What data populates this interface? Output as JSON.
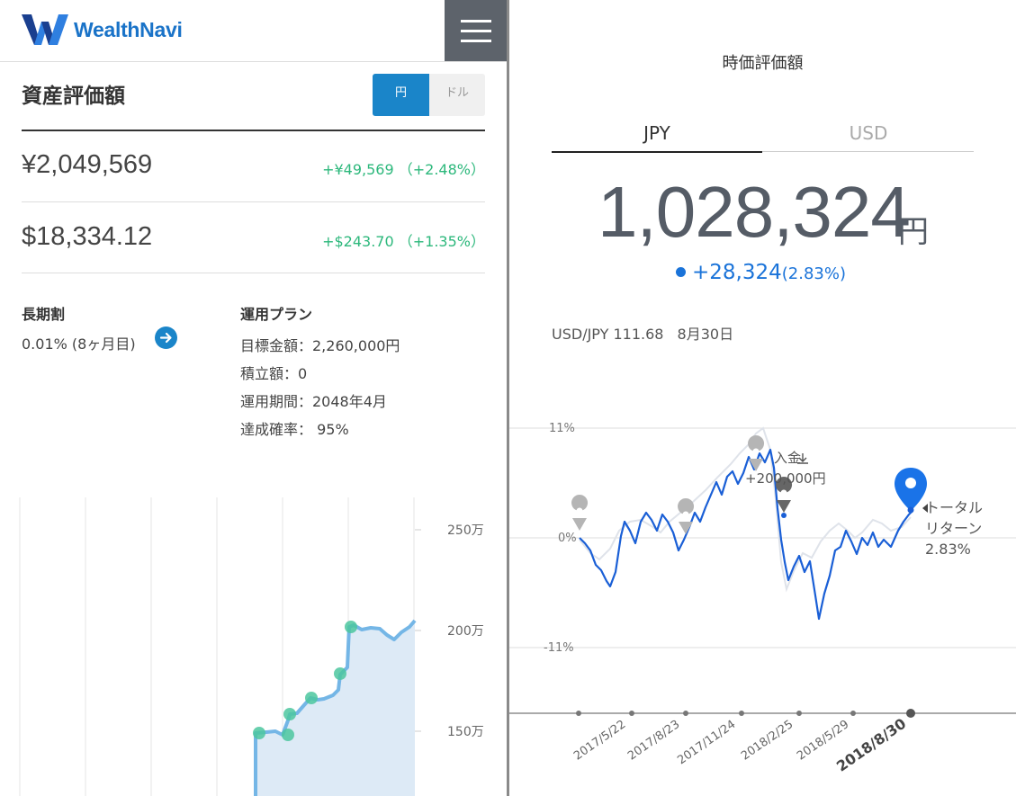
{
  "left": {
    "logo_text": "WealthNavi",
    "page_title": "資産評価額",
    "toggle": {
      "yen_label": "円",
      "dollar_label": "ドル"
    },
    "jpy": {
      "amount": "¥2,049,569",
      "change": "+¥49,569 （+2.48%）"
    },
    "usd": {
      "amount": "$18,334.12",
      "change": "+$243.70 （+1.35%）"
    },
    "long_term": {
      "heading": "長期割",
      "value": "0.01% (8ヶ月目)"
    },
    "plan": {
      "heading": "運用プラン",
      "target": "目標金額：2,260,000円",
      "accumulation": "積立額：0",
      "period": "運用期間：2048年4月",
      "probability": "達成確率： 95%"
    },
    "chart": {
      "y_ticks": [
        "250万",
        "200万",
        "150万"
      ]
    }
  },
  "right": {
    "title": "時価評価額",
    "tabs": [
      "JPY",
      "USD"
    ],
    "value": "1,028,324",
    "unit": "円",
    "gain_amount": "+28,324",
    "gain_percent": "(2.83%)",
    "fx_rate": "USD/JPY 111.68",
    "fx_date": "8月30日",
    "deposit_label": "入金",
    "deposit_amount": "+200,000円",
    "total_return_line1": "トータル",
    "total_return_line2": "リターン",
    "total_return_value": "2.83%",
    "y_ticks": [
      "11%",
      "0%",
      "-11%"
    ],
    "x_ticks": [
      "2017/5/22",
      "2017/8/23",
      "2017/11/24",
      "2018/2/25",
      "2018/5/29",
      "2018/8/30"
    ]
  },
  "colors": {
    "brand": "#1a73c8",
    "accent": "#1a85c9",
    "positive": "#2db87c",
    "series": "#1a5fd6"
  }
}
